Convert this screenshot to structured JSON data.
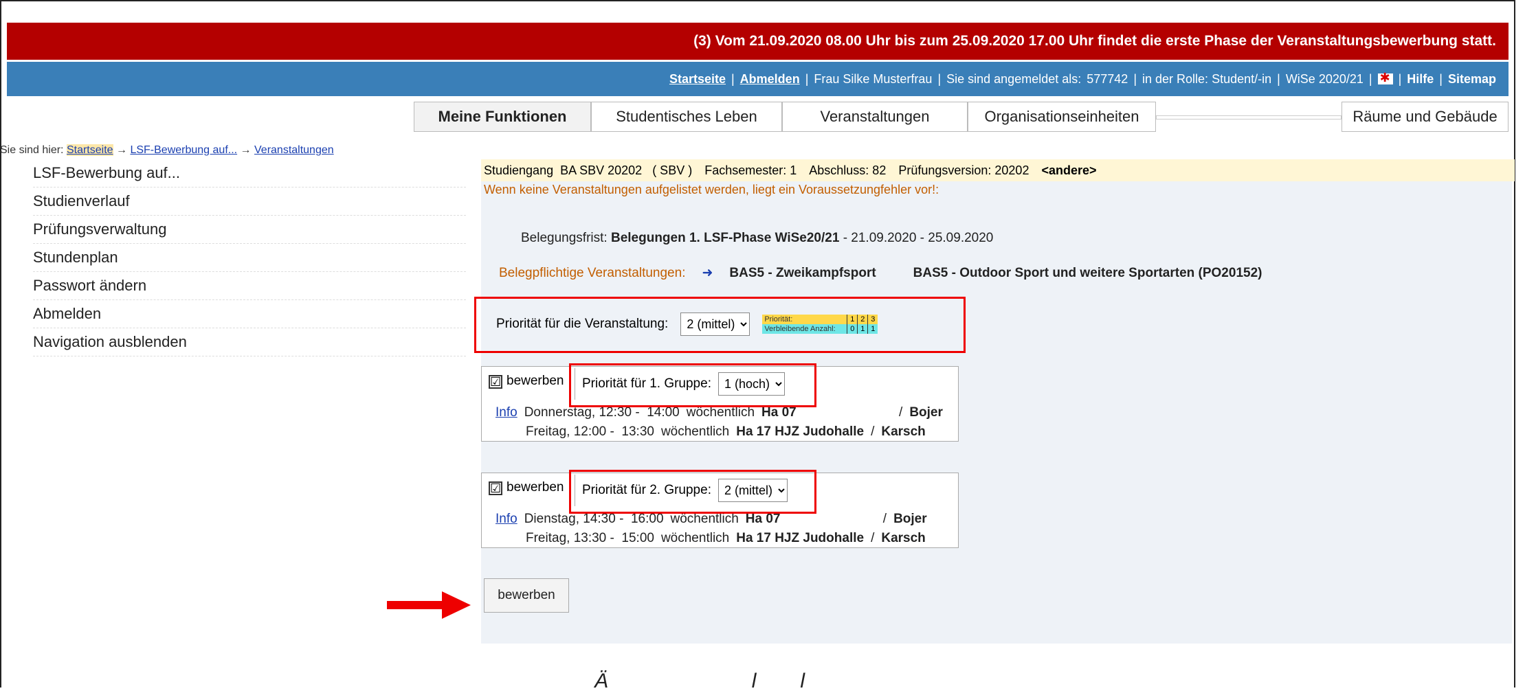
{
  "announcement": "(3) Vom 21.09.2020 08.00 Uhr bis zum 25.09.2020 17.00 Uhr findet die erste Phase der Veranstaltungsbewerbung statt.",
  "topbar": {
    "startseite": "Startseite",
    "abmelden": "Abmelden",
    "user": "Frau Silke Musterfrau",
    "angemeldet": "Sie sind angemeldet als:",
    "user_id": "577742",
    "rolle": "in der Rolle: Student/-in",
    "semester": "WiSe 2020/21",
    "hilfe": "Hilfe",
    "sitemap": "Sitemap",
    "sep": "|"
  },
  "tabs": [
    "Meine Funktionen",
    "Studentisches Leben",
    "Veranstaltungen",
    "Organisationseinheiten",
    "",
    "Räume und Gebäude"
  ],
  "breadcrumb": {
    "prefix": "Sie sind hier:",
    "items": [
      "Startseite",
      "LSF-Bewerbung auf...",
      "Veranstaltungen"
    ],
    "arrow": "→"
  },
  "sidenav": [
    "LSF-Bewerbung auf...",
    "Studienverlauf",
    "Prüfungsverwaltung",
    "Stundenplan",
    "Passwort ändern",
    "Abmelden",
    "Navigation ausblenden"
  ],
  "studiengang": {
    "studiengang": "Studiengang  BA SBV 20202   ( SBV )",
    "fachsemester": "Fachsemester: 1",
    "abschluss": "Abschluss: 82",
    "pruefungsversion": "Prüfungsversion: 20202",
    "andere": "<andere>"
  },
  "warning": "Wenn keine Veranstaltungen aufgelistet werden, liegt ein Voraussetzungfehler vor!:",
  "belegungsfrist": {
    "label": "Belegungsfrist:",
    "name": "Belegungen 1. LSF-Phase WiSe20/21",
    "dates": "- 21.09.2020 - 25.09.2020"
  },
  "belegpflichtig": {
    "label": "Belegpflichtige Veranstaltungen:",
    "arrow": "➜",
    "course": "BAS5 - Zweikampfsport",
    "module": "BAS5 - Outdoor Sport und weitere Sportarten (PO20152)"
  },
  "priority": {
    "label": "Priorität für die Veranstaltung:",
    "value": "2 (mittel)",
    "legend_label1": "Priorität:",
    "legend_label2": "Verbleibende Anzahl:",
    "legend_prios": [
      "1",
      "2",
      "3"
    ],
    "legend_counts": [
      "0",
      "1",
      "1"
    ]
  },
  "groups": [
    {
      "checkbox": "☑",
      "bewerben": "bewerben",
      "prio_label": "Priorität für 1. Gruppe:",
      "prio_value": "1 (hoch)",
      "info": "Info",
      "rows": [
        {
          "day": "Donnerstag, 12:30 -  14:00",
          "freq": "wöchentlich",
          "room": "Ha 07",
          "sep": "/",
          "teacher": "Bojer"
        },
        {
          "day": "Freitag, 12:00 -  13:30",
          "freq": "wöchentlich",
          "room": "Ha 17 HJZ Judohalle",
          "sep": "/",
          "teacher": "Karsch"
        }
      ]
    },
    {
      "checkbox": "☑",
      "bewerben": "bewerben",
      "prio_label": "Priorität für 2. Gruppe:",
      "prio_value": "2 (mittel)",
      "info": "Info",
      "rows": [
        {
          "day": "Dienstag, 14:30 -  16:00",
          "freq": "wöchentlich",
          "room": "Ha 07",
          "sep": "/",
          "teacher": "Bojer"
        },
        {
          "day": "Freitag, 13:30 -  15:00",
          "freq": "wöchentlich",
          "room": "Ha 17 HJZ Judohalle",
          "sep": "/",
          "teacher": "Karsch"
        }
      ]
    }
  ],
  "submit": "bewerben",
  "bottom_text": "Ä                    l      l"
}
